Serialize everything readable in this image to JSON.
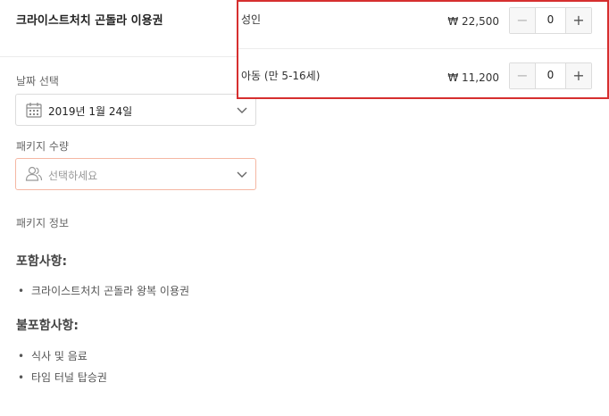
{
  "header": {
    "title": "크라이스트처치 곤돌라 이용권"
  },
  "date_select": {
    "label": "날짜 선택",
    "value": "2019년 1월 24일"
  },
  "package_qty": {
    "label": "패키지 수량",
    "placeholder": "선택하세요"
  },
  "package_info": {
    "label": "패키지 정보",
    "included_heading": "포함사항:",
    "included_items": [
      "크라이스트처치 곤돌라 왕복 이용권"
    ],
    "excluded_heading": "불포함사항:",
    "excluded_items": [
      "식사 및 음료",
      "타임 터널 탑승권"
    ]
  },
  "ticket_options": [
    {
      "name": "성인",
      "price": "₩ 22,500",
      "quantity": "0"
    },
    {
      "name": "아동 (만 5-16세)",
      "price": "₩ 11,200",
      "quantity": "0"
    }
  ],
  "stepper": {
    "minus": "−",
    "plus": "+"
  },
  "colors": {
    "highlight_border": "#d62f2f",
    "focus_border": "#f5b7a3"
  },
  "icons": {
    "date": "calendar-icon",
    "qty": "people-icon",
    "dropdown": "chevron-down-icon"
  }
}
